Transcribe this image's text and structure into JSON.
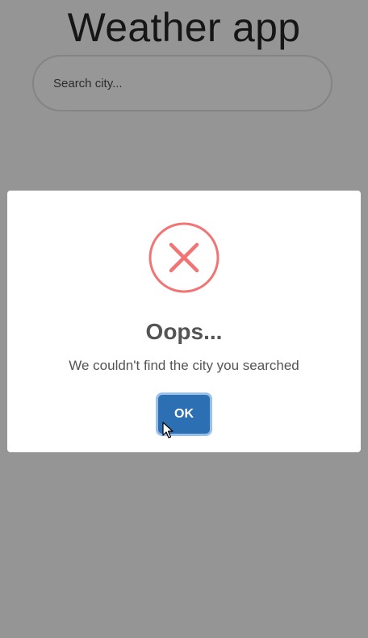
{
  "app": {
    "title": "Weather app",
    "search": {
      "placeholder": "Search city...",
      "value": ""
    }
  },
  "modal": {
    "icon": "error-x-icon",
    "title": "Oops...",
    "text": "We couldn't find the city you searched",
    "ok_label": "OK"
  },
  "colors": {
    "overlay_background": "#959595",
    "modal_background": "#ffffff",
    "error_icon": "#f27474",
    "ok_button": "#2c6fb3",
    "ok_button_focus_ring": "#78aae1",
    "text": "#545454"
  },
  "icons": {
    "error": "circle-x-icon",
    "cursor": "mouse-pointer-icon"
  }
}
